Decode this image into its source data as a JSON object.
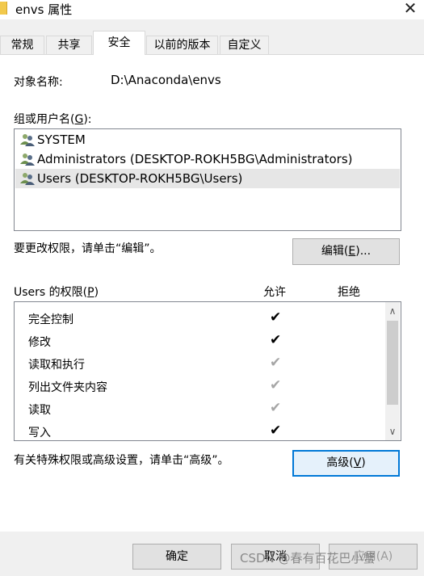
{
  "window": {
    "title": "envs 属性",
    "close_glyph": "✕",
    "folder_icon": "folder-icon"
  },
  "tabs": [
    {
      "label": "常规",
      "active": false
    },
    {
      "label": "共享",
      "active": false
    },
    {
      "label": "安全",
      "active": true
    },
    {
      "label": "以前的版本",
      "active": false
    },
    {
      "label": "自定义",
      "active": false
    }
  ],
  "object": {
    "label": "对象名称:",
    "value": "D:\\Anaconda\\envs"
  },
  "groups": {
    "label_prefix": "组或用户名(",
    "label_key": "G",
    "label_suffix": "):",
    "items": [
      {
        "name": "SYSTEM",
        "selected": false
      },
      {
        "name": "Administrators (DESKTOP-ROKH5BG\\Administrators)",
        "selected": false
      },
      {
        "name": "Users (DESKTOP-ROKH5BG\\Users)",
        "selected": true
      }
    ]
  },
  "edit": {
    "hint": "要更改权限，请单击“编辑”。",
    "button_prefix": "编辑(",
    "button_key": "E",
    "button_suffix": ")..."
  },
  "permissions": {
    "label_prefix": "Users 的权限(",
    "label_key": "P",
    "label_suffix": ")",
    "allow_header": "允许",
    "deny_header": "拒绝",
    "check_glyph": "✔",
    "scroll_up": "∧",
    "scroll_down": "∨",
    "items": [
      {
        "name": "完全控制",
        "allow": true,
        "inherited": false
      },
      {
        "name": "修改",
        "allow": true,
        "inherited": false
      },
      {
        "name": "读取和执行",
        "allow": true,
        "inherited": true
      },
      {
        "name": "列出文件夹内容",
        "allow": true,
        "inherited": true
      },
      {
        "name": "读取",
        "allow": true,
        "inherited": true
      },
      {
        "name": "写入",
        "allow": true,
        "inherited": false
      }
    ]
  },
  "advanced": {
    "hint": "有关特殊权限或高级设置，请单击“高级”。",
    "button_prefix": "高级(",
    "button_key": "V",
    "button_suffix": ")"
  },
  "footer": {
    "ok": "确定",
    "cancel": "取消",
    "apply": "应用(A)"
  },
  "watermark": "CSDN @春有百花巴小蟹"
}
